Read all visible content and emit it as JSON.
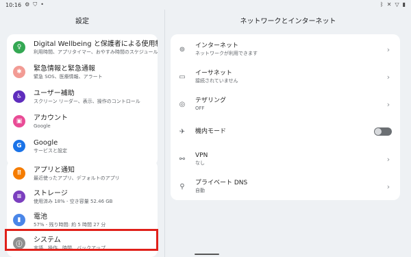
{
  "status_bar": {
    "time": "10:16",
    "icons_left": [
      "gear-icon",
      "shield-icon",
      "dot-icon"
    ],
    "icons_right": [
      "bluetooth-icon",
      "mute-icon",
      "wifi-icon",
      "battery-icon"
    ]
  },
  "left": {
    "title": "設定",
    "group1": [
      {
        "title": "Digital Wellbeing と保護者による使用制限",
        "subtitle": "利用時間、アプリタイマー、おやすみ時間のスケジュール",
        "icon": "wellbeing-icon",
        "color": "#34a853"
      },
      {
        "title": "緊急情報と緊急通報",
        "subtitle": "緊急 SOS、医療情報、アラート",
        "icon": "emergency-icon",
        "color": "#f29b94"
      },
      {
        "title": "ユーザー補助",
        "subtitle": "スクリーン リーダー、表示、操作のコントロール",
        "icon": "accessibility-icon",
        "color": "#5f2dbd"
      },
      {
        "title": "アカウント",
        "subtitle": "Google",
        "icon": "account-icon",
        "color": "#e94c96"
      },
      {
        "title": "Google",
        "subtitle": "サービスと設定",
        "icon": "google-icon",
        "color": "#1a73e8"
      }
    ],
    "group2": [
      {
        "title": "アプリと通知",
        "subtitle": "最近使ったアプリ、デフォルトのアプリ",
        "icon": "apps-icon",
        "color": "#f57c00"
      },
      {
        "title": "ストレージ",
        "subtitle": "使用済み 18% - 空き容量 52.46 GB",
        "icon": "storage-icon",
        "color": "#7b3fbf"
      },
      {
        "title": "電池",
        "subtitle": "57% - 残り時間: 約 5 時間 27 分",
        "icon": "battery-icon",
        "color": "#4a86e8"
      },
      {
        "title": "システム",
        "subtitle": "言語、操作、時間、バックアップ",
        "icon": "system-icon",
        "color": "#8f8f8f"
      }
    ]
  },
  "right": {
    "title": "ネットワークとインターネット",
    "items": [
      {
        "title": "インターネット",
        "subtitle": "ネットワークが利用できます",
        "icon": "internet-icon",
        "control": "chevron"
      },
      {
        "title": "イーサネット",
        "subtitle": "接続されていません",
        "icon": "ethernet-icon",
        "control": "chevron"
      },
      {
        "title": "テザリング",
        "subtitle": "OFF",
        "icon": "tethering-icon",
        "control": "chevron"
      },
      {
        "title": "機内モード",
        "subtitle": "",
        "icon": "airplane-icon",
        "control": "toggle",
        "toggle_on": false
      },
      {
        "title": "VPN",
        "subtitle": "なし",
        "icon": "vpn-icon",
        "control": "chevron"
      },
      {
        "title": "プライベート DNS",
        "subtitle": "自動",
        "icon": "dns-icon",
        "control": "chevron"
      }
    ]
  },
  "highlight_color": "#e0201a"
}
